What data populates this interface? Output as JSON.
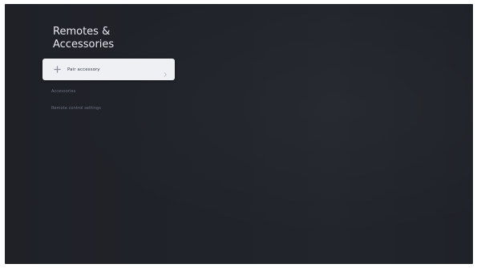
{
  "screen": {
    "title_lines": [
      "Remotes &",
      "Accessories"
    ]
  },
  "menu": {
    "selected_item": {
      "icon": "add-icon",
      "label": "Pair accessory",
      "chevron": "chevron-right-icon"
    },
    "items": [
      {
        "label": "Accessories"
      },
      {
        "label": "Remote control settings"
      }
    ]
  },
  "colors": {
    "background": "#20232a",
    "selected_bg": "#eef0f4",
    "title_text": "#e6e8ee",
    "muted_text": "#6d727d"
  }
}
